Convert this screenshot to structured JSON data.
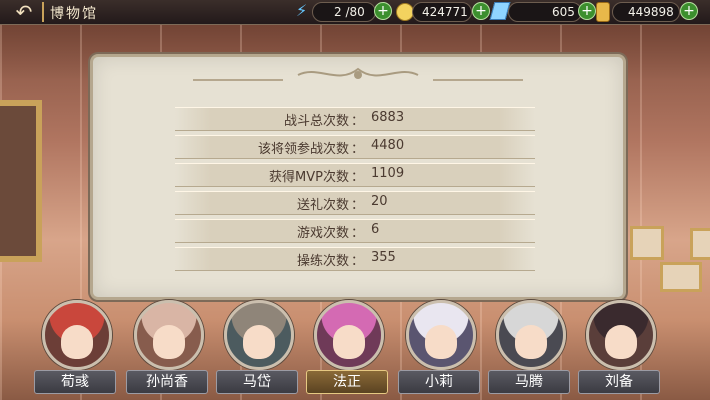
{
  "header": {
    "title": "博物馆",
    "back_icon": "back-arrow-icon"
  },
  "resources": {
    "stamina": "2 /80",
    "coins": "424771",
    "gems": "605",
    "gold": "449898"
  },
  "stats": [
    {
      "label": "战斗总次数",
      "value": "6883"
    },
    {
      "label": "该将领参战次数",
      "value": "4480"
    },
    {
      "label": "获得MVP次数",
      "value": "1109"
    },
    {
      "label": "送礼次数",
      "value": "20"
    },
    {
      "label": "游戏次数",
      "value": "6"
    },
    {
      "label": "操练次数",
      "value": "355"
    }
  ],
  "stat_colon": "：",
  "characters": [
    {
      "name": "荀彧",
      "hair": "#c9473c",
      "bg": "#6c3e37",
      "selected": false
    },
    {
      "name": "孙尚香",
      "hair": "#d9b5a5",
      "bg": "#875c4d",
      "selected": false
    },
    {
      "name": "马岱",
      "hair": "#8f8579",
      "bg": "#4c5b5f",
      "selected": false
    },
    {
      "name": "法正",
      "hair": "#d46ab3",
      "bg": "#6f3a58",
      "selected": true
    },
    {
      "name": "小莉",
      "hair": "#e9e6f0",
      "bg": "#5a5570",
      "selected": false
    },
    {
      "name": "马腾",
      "hair": "#d7d7d7",
      "bg": "#4a4a52",
      "selected": false
    },
    {
      "name": "刘备",
      "hair": "#3a2a2e",
      "bg": "#5a3e3a",
      "selected": false
    }
  ]
}
